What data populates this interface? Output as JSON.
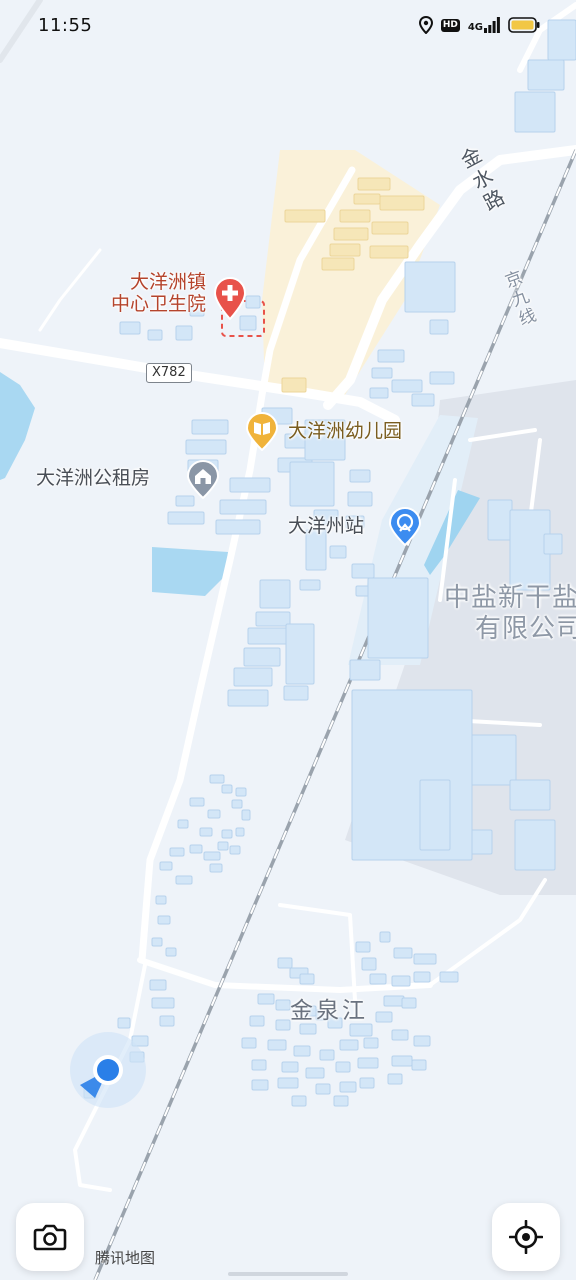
{
  "status_bar": {
    "time": "11:55",
    "icons": [
      "location-icon",
      "hd-icon",
      "signal-4g-icon",
      "battery-icon"
    ],
    "hd_label": "HD",
    "network_label": "4G"
  },
  "map": {
    "road_shield": "X782",
    "road_name": "金水路",
    "rail_name": "京九线",
    "pois": {
      "hospital": {
        "line1": "大洋洲镇",
        "line2": "中心卫生院",
        "icon": "hospital-cross-icon"
      },
      "kindergarten": {
        "name": "大洋洲幼儿园",
        "icon": "school-book-icon"
      },
      "rental_housing": {
        "name": "大洋洲公租房",
        "icon": "housing-icon"
      },
      "station": {
        "name": "大洋州站",
        "icon": "train-station-icon"
      },
      "company": {
        "line1": "中盐新干盐",
        "line2": "有限公司"
      },
      "village": {
        "name": "金泉江"
      }
    },
    "user_location": {
      "icon": "user-location-dot-icon"
    }
  },
  "controls": {
    "camera": {
      "icon": "camera-icon"
    },
    "locate": {
      "icon": "locate-crosshair-icon"
    }
  },
  "attribution": "腾讯地图",
  "colors": {
    "background": "#eef3f9",
    "building": "#d3e6f7",
    "building_stroke": "#b7d2ec",
    "water": "#a9d8f2",
    "campus": "#faf1d9",
    "road": "#ffffff",
    "hospital_accent": "#e8524a",
    "school_accent": "#f0b33a",
    "station_accent": "#3c8cf0",
    "location_blue": "#2a7fe8"
  }
}
